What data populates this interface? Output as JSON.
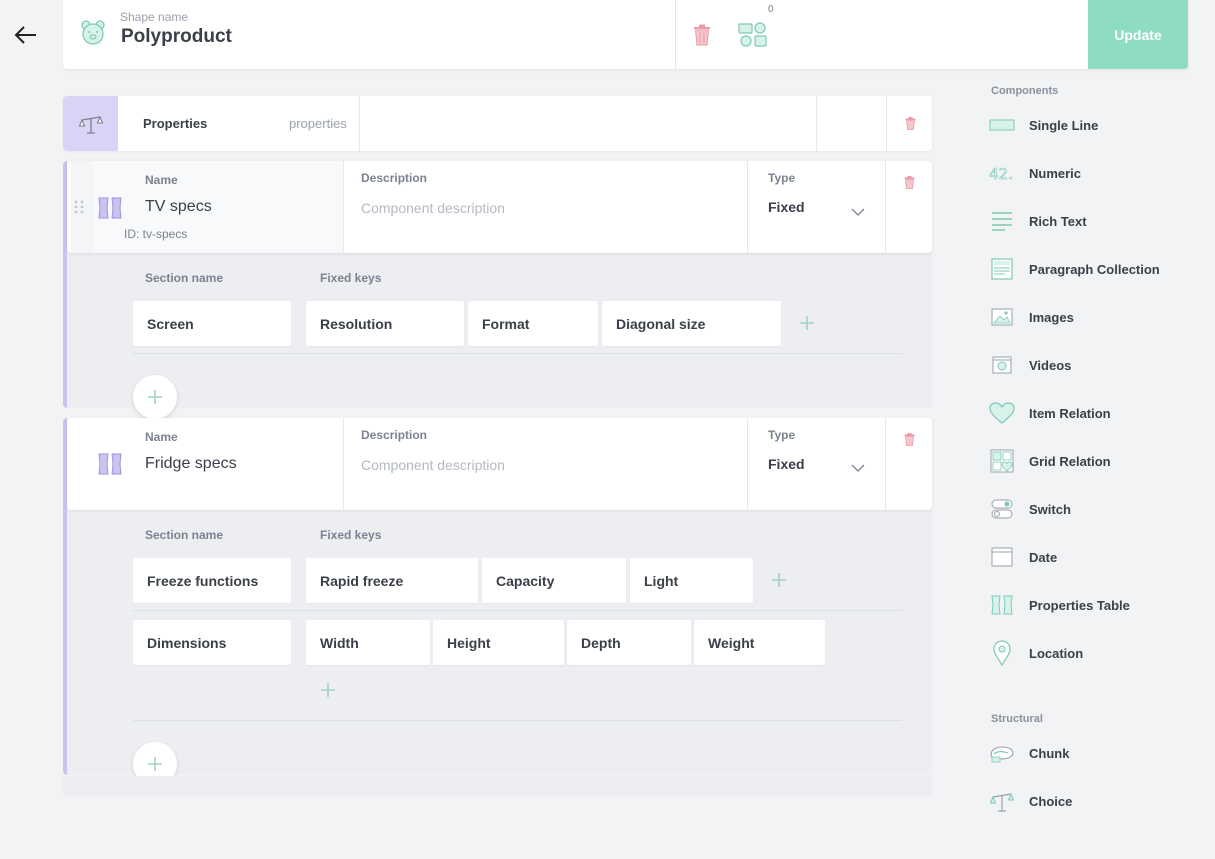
{
  "header": {
    "shape_label": "Shape name",
    "shape_name": "Polyproduct",
    "count": "0",
    "update_label": "Update"
  },
  "properties": {
    "title": "Properties",
    "identifier": "properties"
  },
  "components": [
    {
      "name_label": "Name",
      "name": "TV specs",
      "id_text": "ID: tv-specs",
      "description_label": "Description",
      "description_placeholder": "Component description",
      "type_label": "Type",
      "type": "Fixed",
      "section_label": "Section name",
      "keys_label": "Fixed keys",
      "sections": [
        {
          "name": "Screen",
          "keys": [
            "Resolution",
            "Format",
            "Diagonal size"
          ]
        }
      ]
    },
    {
      "name_label": "Name",
      "name": "Fridge specs",
      "description_label": "Description",
      "description_placeholder": "Component description",
      "type_label": "Type",
      "type": "Fixed",
      "section_label": "Section name",
      "keys_label": "Fixed keys",
      "sections": [
        {
          "name": "Freeze functions",
          "keys": [
            "Rapid freeze",
            "Capacity",
            "Light"
          ]
        },
        {
          "name": "Dimensions",
          "keys": [
            "Width",
            "Height",
            "Depth",
            "Weight"
          ]
        }
      ]
    }
  ],
  "sidebar": {
    "components_title": "Components",
    "components": [
      {
        "label": "Single Line",
        "icon": "single-line-icon"
      },
      {
        "label": "Numeric",
        "icon": "numeric-icon"
      },
      {
        "label": "Rich Text",
        "icon": "rich-text-icon"
      },
      {
        "label": "Paragraph Collection",
        "icon": "paragraph-collection-icon"
      },
      {
        "label": "Images",
        "icon": "images-icon"
      },
      {
        "label": "Videos",
        "icon": "videos-icon"
      },
      {
        "label": "Item Relation",
        "icon": "heart-icon"
      },
      {
        "label": "Grid Relation",
        "icon": "grid-relation-icon"
      },
      {
        "label": "Switch",
        "icon": "switch-icon"
      },
      {
        "label": "Date",
        "icon": "calendar-icon"
      },
      {
        "label": "Properties Table",
        "icon": "properties-table-icon"
      },
      {
        "label": "Location",
        "icon": "location-pin-icon"
      }
    ],
    "structural_title": "Structural",
    "structural": [
      {
        "label": "Chunk",
        "icon": "chunk-icon"
      },
      {
        "label": "Choice",
        "icon": "choice-icon"
      }
    ]
  },
  "colors": {
    "accent": "#8fdcc5",
    "accent_stroke": "#7fc9b4",
    "purple": "#c9c3f0",
    "danger": "#e99aa3"
  }
}
